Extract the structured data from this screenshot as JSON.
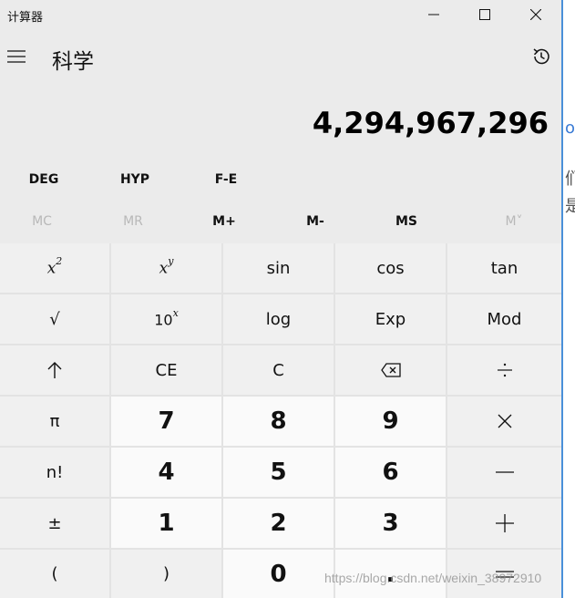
{
  "window": {
    "title": "计算器"
  },
  "header": {
    "mode_title": "科学"
  },
  "display": {
    "value": "4,294,967,296"
  },
  "mode_row": [
    "DEG",
    "HYP",
    "F-E"
  ],
  "memory_row": [
    "MC",
    "MR",
    "M+",
    "M-",
    "MS",
    "M˅"
  ],
  "keys": {
    "sin": "sin",
    "cos": "cos",
    "tan": "tan",
    "log": "log",
    "exp": "Exp",
    "mod": "Mod",
    "ce": "CE",
    "c": "C",
    "pi": "π",
    "factorial": "n!",
    "negate": "±",
    "lparen": "(",
    "rparen": ")",
    "decimal": ".",
    "sqrt": "√",
    "d7": "7",
    "d8": "8",
    "d9": "9",
    "d4": "4",
    "d5": "5",
    "d6": "6",
    "d1": "1",
    "d2": "2",
    "d3": "3",
    "d0": "0",
    "x": "x",
    "y": "y",
    "two": "2",
    "ten": "10"
  },
  "icons": {
    "minimize": "minimize-icon",
    "maximize": "maximize-icon",
    "close": "close-icon",
    "menu": "hamburger-icon",
    "history": "history-icon",
    "shift": "up-arrow-icon",
    "backspace": "backspace-icon",
    "divide": "divide-icon",
    "multiply": "multiply-icon",
    "minus": "minus-icon",
    "plus": "plus-icon",
    "equals": "equals-icon"
  },
  "watermark": "https://blog.csdn.net/weixin_38972910",
  "background_peek": [
    "og",
    "们文",
    "是任"
  ]
}
